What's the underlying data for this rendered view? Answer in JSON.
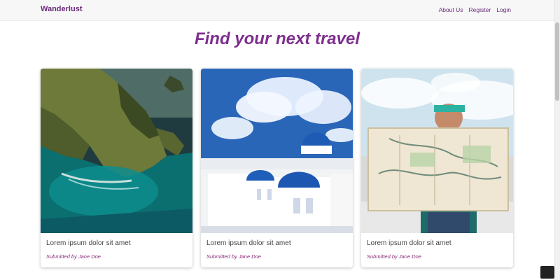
{
  "navbar": {
    "brand": "Wanderlust",
    "links": [
      "About Us",
      "Register",
      "Login"
    ]
  },
  "page": {
    "title": "Find your next travel"
  },
  "cards": [
    {
      "title": "Lorem ipsum dolor sit amet",
      "submitted": "Submitted by Jane Doe",
      "image_icon": "coastal-cliff-image"
    },
    {
      "title": "Lorem ipsum dolor sit amet",
      "submitted": "Submitted by Jane Doe",
      "image_icon": "santorini-domes-image"
    },
    {
      "title": "Lorem ipsum dolor sit amet",
      "submitted": "Submitted by Jane Doe",
      "image_icon": "traveler-with-map-image"
    }
  ],
  "colors": {
    "brand": "#6a2b78",
    "title": "#7e2f8e",
    "submitted": "#8b2b7a",
    "navbar_bg": "#f7f7f8"
  }
}
